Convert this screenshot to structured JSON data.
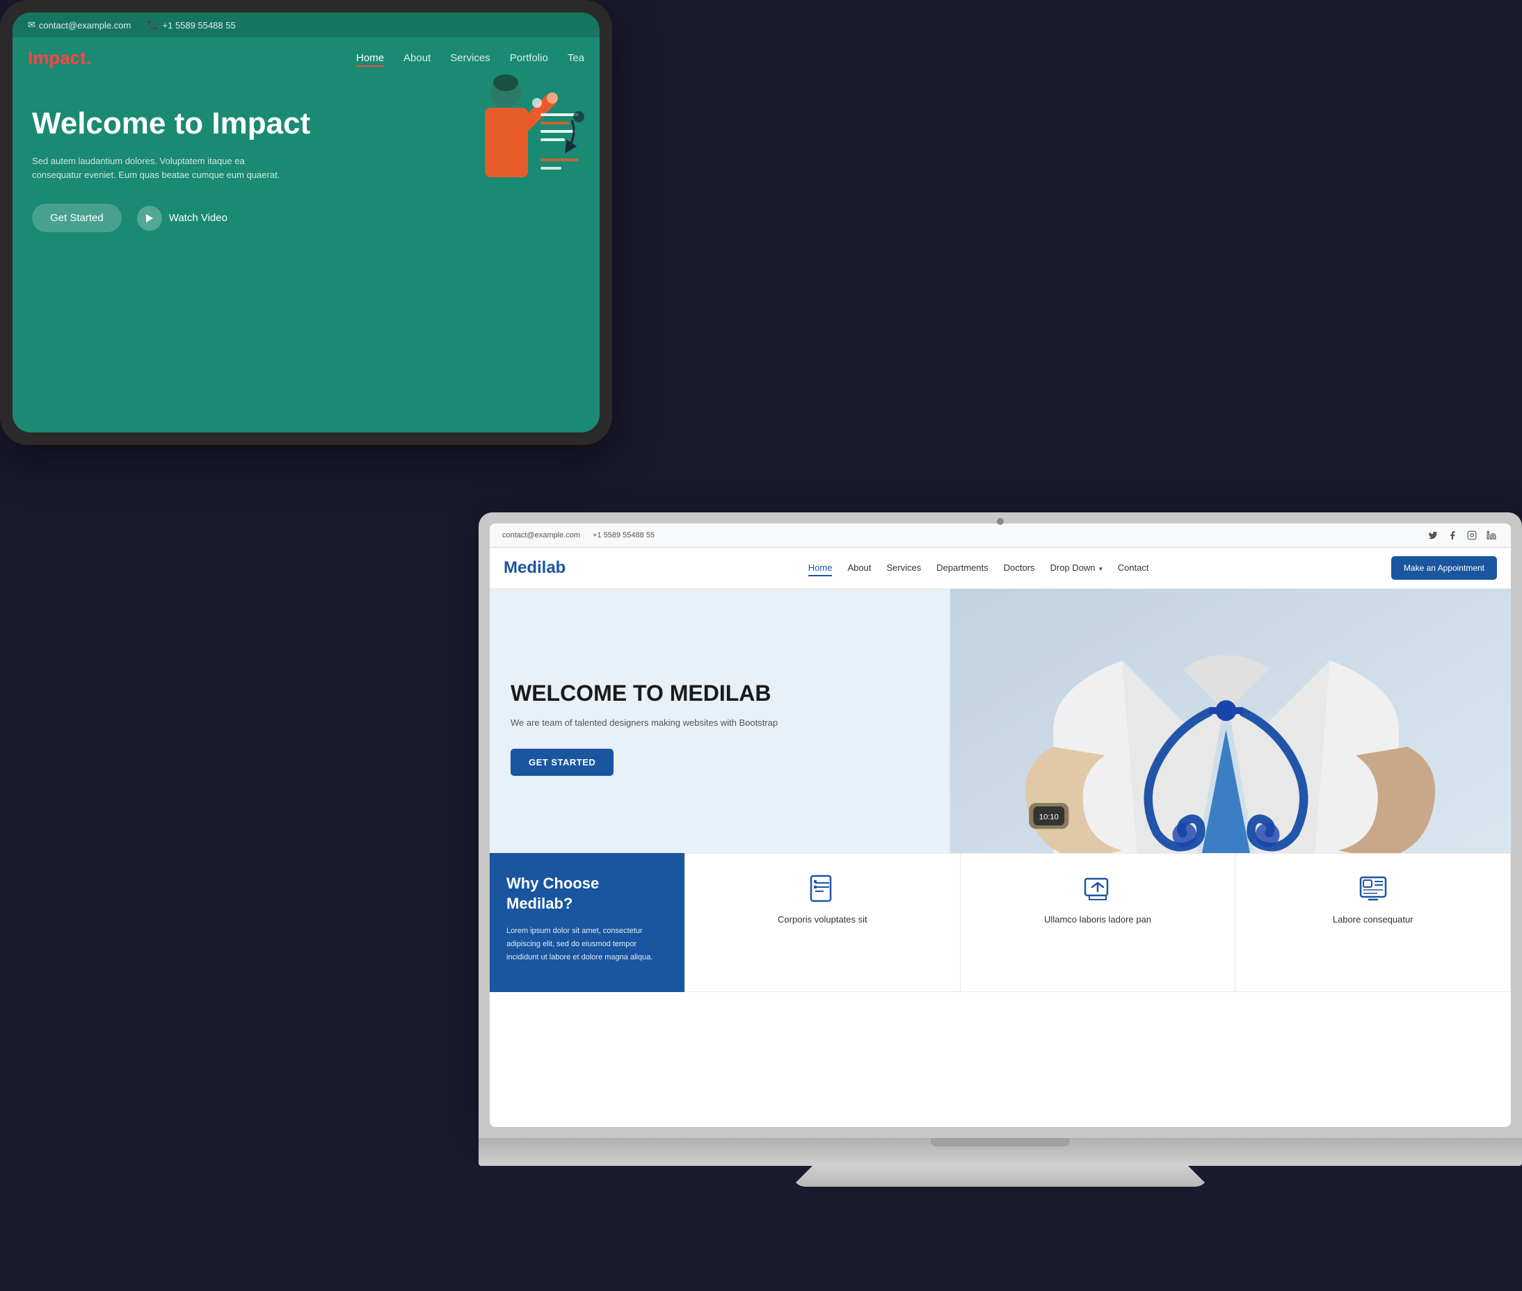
{
  "scene": {
    "background_color": "#111111"
  },
  "tablet": {
    "topbar": {
      "email": "contact@example.com",
      "phone": "+1 5589 55488 55"
    },
    "logo": {
      "text": "Impact",
      "dot_color": "#ff4444"
    },
    "nav": {
      "items": [
        {
          "label": "Home",
          "active": true
        },
        {
          "label": "About"
        },
        {
          "label": "Services"
        },
        {
          "label": "Portfolio"
        },
        {
          "label": "Tea"
        }
      ]
    },
    "hero": {
      "title": "Welcome to Impact",
      "subtitle": "Sed autem laudantium dolores. Voluptatem itaque ea consequatur eveniet. Eum quas beatae cumque eum quaerat.",
      "btn_started": "Get Started",
      "btn_video": "Watch Video"
    }
  },
  "laptop": {
    "topbar": {
      "email": "contact@example.com",
      "phone": "+1 5589 55488 55",
      "social_icons": [
        "twitter",
        "facebook",
        "instagram",
        "linkedin"
      ]
    },
    "navbar": {
      "logo": "Medilab",
      "nav_items": [
        {
          "label": "Home",
          "active": true
        },
        {
          "label": "About"
        },
        {
          "label": "Services"
        },
        {
          "label": "Departments"
        },
        {
          "label": "Doctors"
        },
        {
          "label": "Drop Down",
          "dropdown": true
        },
        {
          "label": "Contact"
        }
      ],
      "btn_appointment": "Make an Appointment"
    },
    "hero": {
      "title": "WELCOME TO MEDILAB",
      "subtitle": "We are team of talented designers making websites with Bootstrap",
      "btn_started": "GET STARTED"
    },
    "why_section": {
      "title": "Why Choose Medilab?",
      "text": "Lorem ipsum dolor sit amet, consectetur adipiscing elit, sed do eiusmod tempor incididunt ut labore et dolore magna aliqua.",
      "feature_cards": [
        {
          "icon": "document-list",
          "title": "Corporis voluptates sit"
        },
        {
          "icon": "share-box",
          "title": "Ullamco laboris ladore pan"
        },
        {
          "icon": "image-list",
          "title": "Labore consequatur"
        }
      ]
    }
  }
}
